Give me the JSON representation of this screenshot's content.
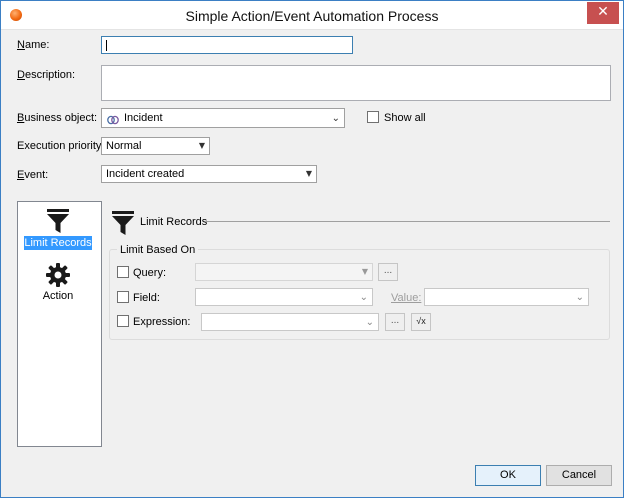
{
  "window": {
    "title": "Simple Action/Event Automation Process",
    "close_glyph": "✕"
  },
  "form": {
    "name_label": "Name:",
    "name_value": "",
    "description_label": "Description:",
    "description_value": "",
    "business_object_label": "Business object:",
    "business_object_value": "Incident",
    "business_object_icon": "incident-icon",
    "show_all_label": "Show all",
    "execution_priority_label": "Execution priority:",
    "execution_priority_value": "Normal",
    "event_label": "Event:",
    "event_value": "Incident created"
  },
  "nav": {
    "items": [
      {
        "label": "Limit Records",
        "icon": "funnel-icon",
        "selected": true
      },
      {
        "label": "Action",
        "icon": "gear-icon",
        "selected": false
      }
    ]
  },
  "section": {
    "title": "Limit Records",
    "group_title": "Limit Based On",
    "query_label": "Query:",
    "field_label": "Field:",
    "value_label": "Value:",
    "expression_label": "Expression:",
    "ellipsis": "...",
    "formula_glyph": "√x"
  },
  "buttons": {
    "ok": "OK",
    "cancel": "Cancel"
  },
  "colors": {
    "accent": "#3399ff",
    "close": "#c75050",
    "border": "#3b7fc4"
  }
}
